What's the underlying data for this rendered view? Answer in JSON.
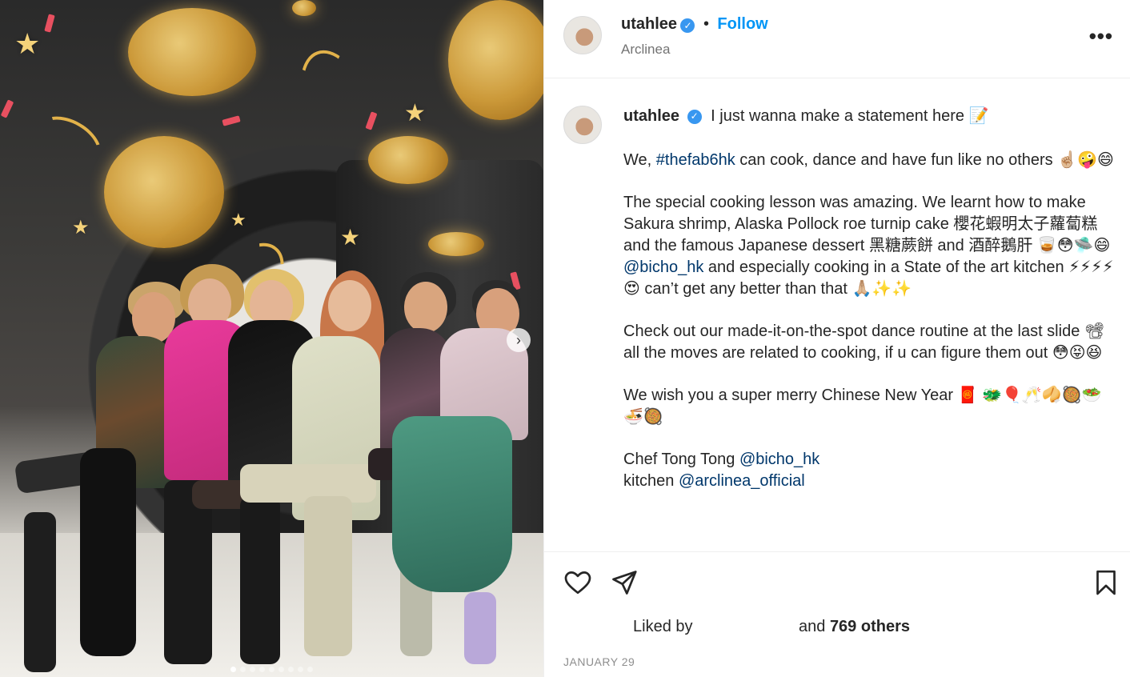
{
  "post": {
    "media": {
      "carousel_total": 9,
      "carousel_active": 1,
      "next_icon": "chevron-right-icon"
    },
    "header": {
      "username": "utahlee",
      "verified_icon": "verified-badge-icon",
      "separator": "•",
      "follow_label": "Follow",
      "location": "Arclinea",
      "more_icon": "more-options-icon"
    },
    "caption": {
      "username": "utahlee",
      "line1": "I just wanna make a statement here 📝",
      "p2_pre": "We, ",
      "p2_tag": "#thefab6hk",
      "p2_post": " can cook, dance and have fun like no others ☝🏼🤪😄",
      "p3_a": "The special cooking lesson was amazing. We learnt how to make Sakura shrimp, Alaska Pollock roe turnip cake 櫻花蝦明太子蘿蔔糕 and the famous Japanese dessert 黑糖蕨餅 and 酒醉鵝肝 🥃😳🛸😄 ",
      "p3_mention": "@bicho_hk",
      "p3_b": " and especially cooking in a State of the art kitchen ⚡⚡⚡⚡😍 can’t get any better than that 🙏🏼✨✨",
      "p4": "Check out our made-it-on-the-spot dance routine at the last slide 📽 all the moves are related to cooking, if u can figure them out 😳😝😆",
      "p5": "We wish you a super merry Chinese New Year 🧧 🐲🎈🥂🥠🥘🥗🍜🥘",
      "p6_chef": "Chef Tong Tong ",
      "p6_chef_mention": "@bicho_hk",
      "p6_kitchen": "kitchen ",
      "p6_kitchen_mention": "@arclinea_official"
    },
    "actions": {
      "like_icon": "heart-icon",
      "share_icon": "paper-plane-icon",
      "save_icon": "bookmark-icon"
    },
    "likes": {
      "liked_by": "Liked by",
      "and": "and",
      "count": "769 others"
    },
    "date": "JANUARY 29"
  },
  "colors": {
    "follow": "#0095f6",
    "link": "#00376b",
    "verified": "#3897f0",
    "muted": "#737373"
  }
}
